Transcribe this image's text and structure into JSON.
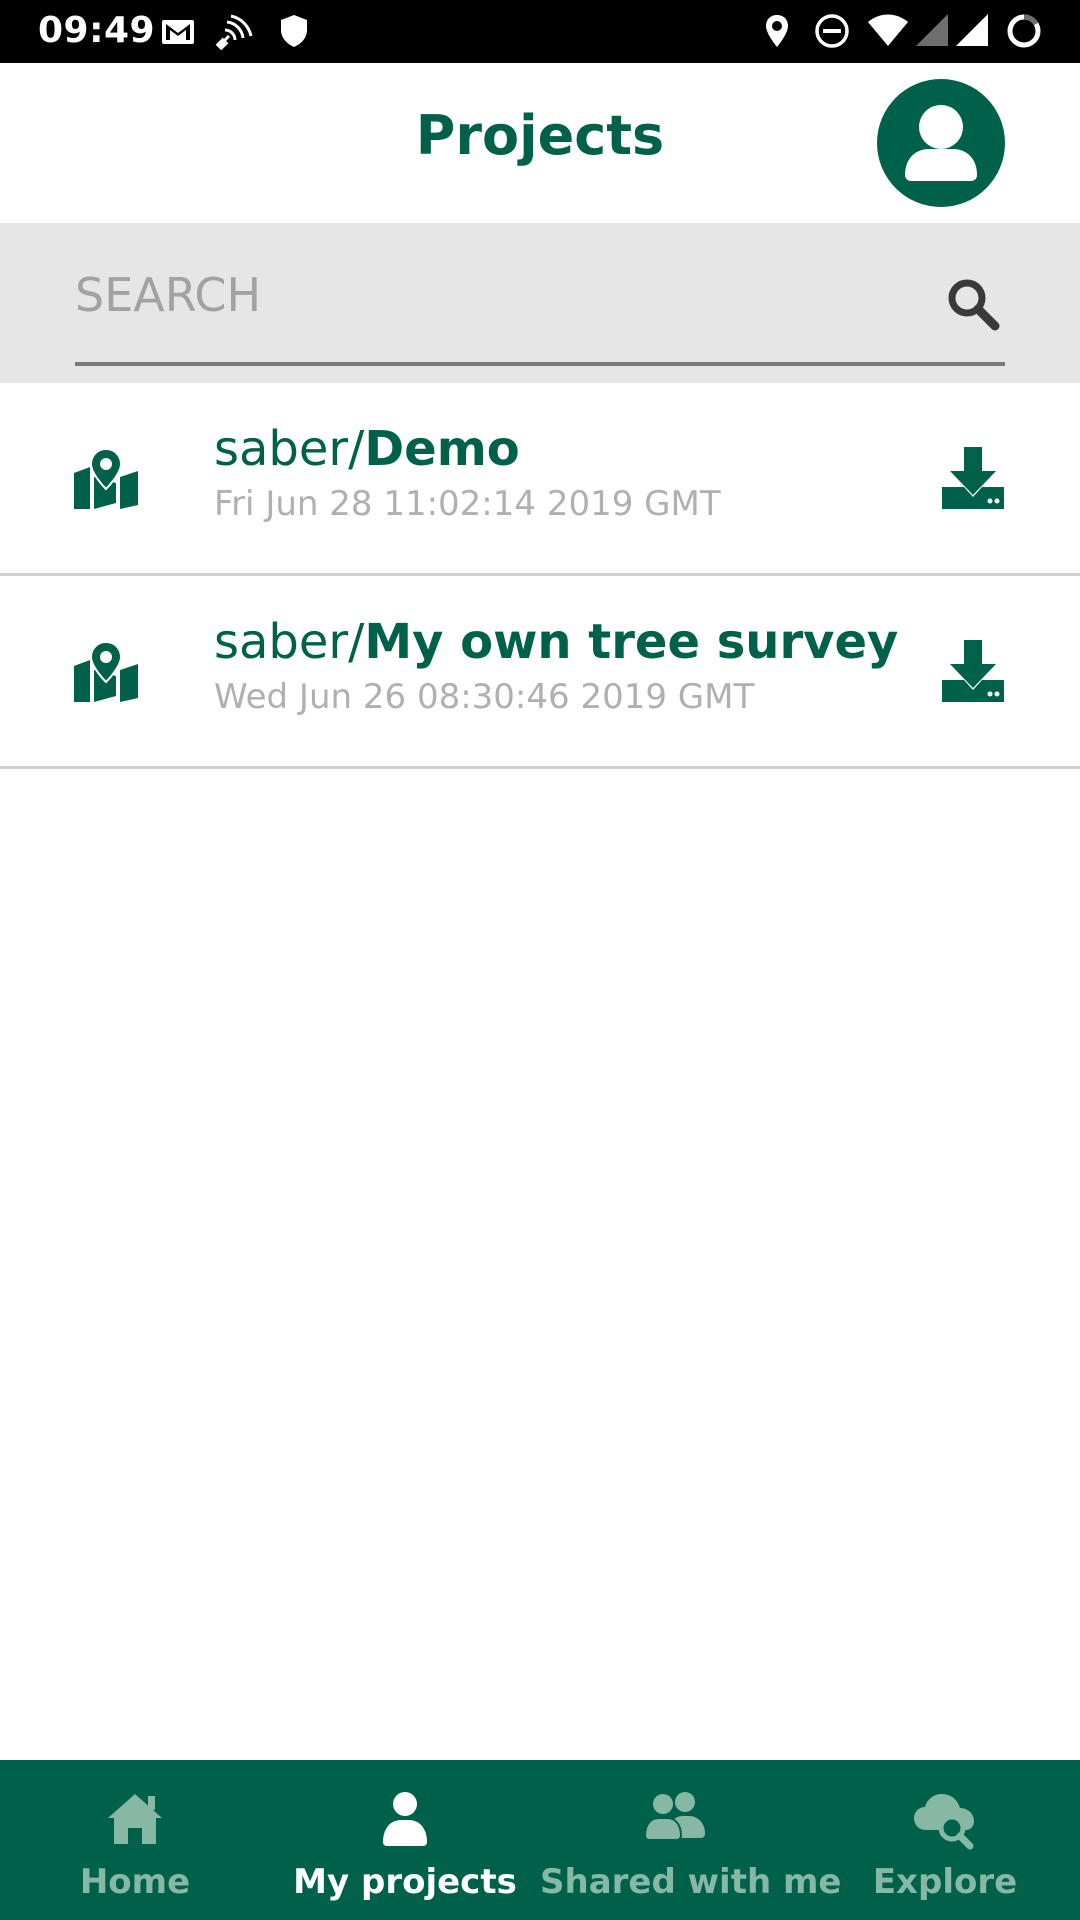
{
  "status_bar": {
    "time": "09:49",
    "left_icons": [
      "gmail-icon",
      "satellite-icon",
      "shield-icon"
    ],
    "right_icons": [
      "location-icon",
      "do-not-disturb-icon",
      "wifi-icon",
      "cell-signal-icon",
      "cell-signal-icon",
      "battery-charging-icon"
    ]
  },
  "header": {
    "title": "Projects",
    "avatar_icon": "user-icon"
  },
  "search": {
    "placeholder": "SEARCH",
    "value": "",
    "icon": "search-icon"
  },
  "projects": [
    {
      "owner": "saber/",
      "name": "Demo",
      "date": "Fri Jun 28 11:02:14 2019 GMT",
      "icon": "map-marker-icon",
      "action_icon": "download-icon"
    },
    {
      "owner": "saber/",
      "name": "My own tree survey",
      "date": "Wed Jun 26 08:30:46 2019 GMT",
      "icon": "map-marker-icon",
      "action_icon": "download-icon"
    }
  ],
  "bottom_nav": {
    "items": [
      {
        "label": "Home",
        "icon": "home-icon",
        "active": false
      },
      {
        "label": "My projects",
        "icon": "user-icon",
        "active": true
      },
      {
        "label": "Shared with me",
        "icon": "users-icon",
        "active": false
      },
      {
        "label": "Explore",
        "icon": "cloud-search-icon",
        "active": false
      }
    ]
  },
  "colors": {
    "brand_green": "#00614a",
    "nav_inactive": "#86b8a5",
    "search_bg": "#e6e6e6",
    "date_gray": "#b0b0b0"
  }
}
